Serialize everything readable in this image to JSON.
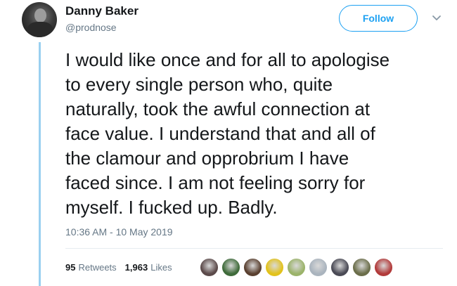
{
  "user": {
    "display_name": "Danny Baker",
    "screen_name": "@prodnose"
  },
  "follow_button": {
    "label": "Follow"
  },
  "tweet": {
    "text": "I would like once and for all to apologise\nto every single person who, quite\nnaturally, took the awful connection at\nface value. I understand that and all of\nthe clamour and opprobrium I have\nfaced since. I am not feeling sorry for\nmyself. I fucked up. Badly.",
    "timestamp": "10:36 AM - 10 May 2019"
  },
  "stats": {
    "retweets_count": "95",
    "retweets_label": "Retweets",
    "likes_count": "1,963",
    "likes_label": "Likes"
  },
  "likers": [
    {
      "color": "#5b4a4a"
    },
    {
      "color": "#3f6b3a"
    },
    {
      "color": "#5a4030"
    },
    {
      "color": "#e2c21c"
    },
    {
      "color": "#9bb36a"
    },
    {
      "color": "#aab4be"
    },
    {
      "color": "#4a4a55"
    },
    {
      "color": "#6b6e4a"
    },
    {
      "color": "#b23a3a"
    }
  ],
  "colors": {
    "accent": "#1da1f2",
    "thread_line": "#9ad0f0",
    "secondary_text": "#657786"
  }
}
